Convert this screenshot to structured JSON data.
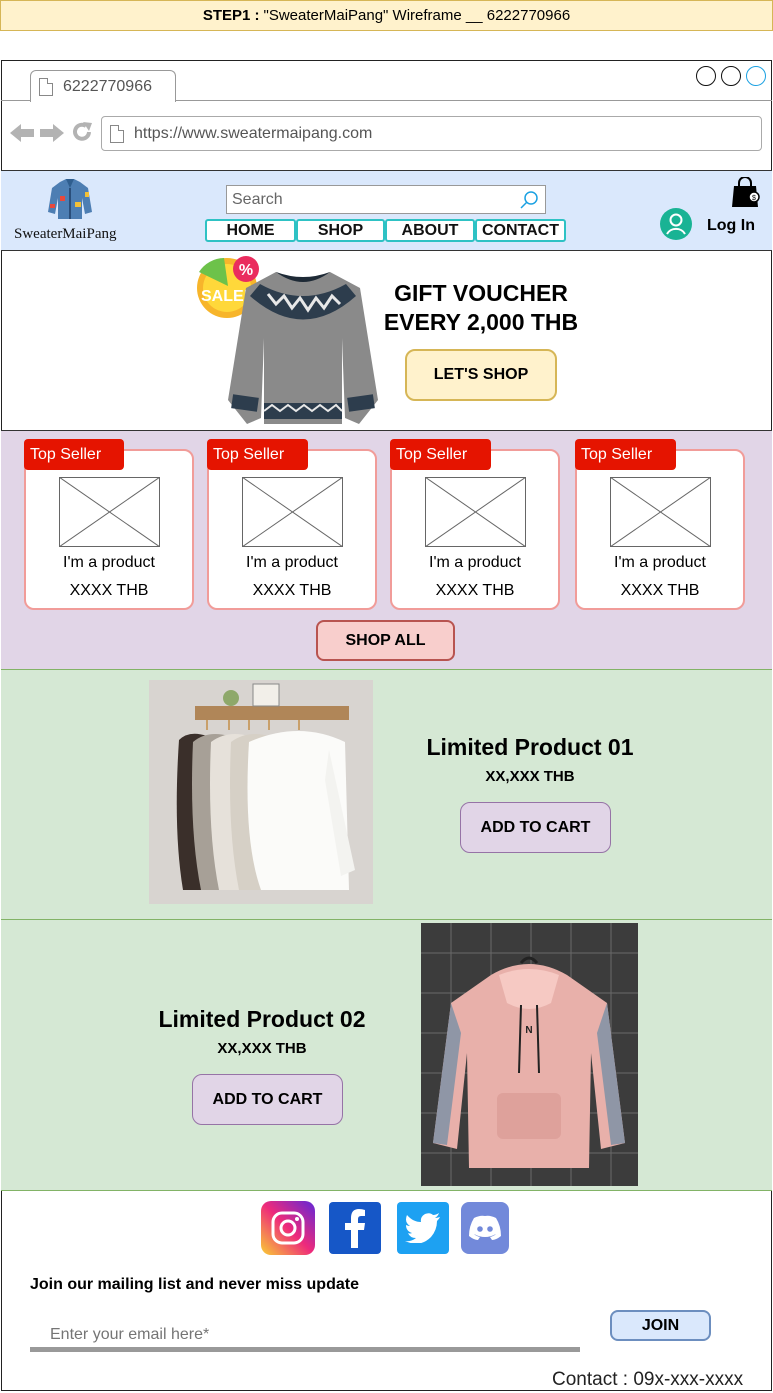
{
  "banner": {
    "prefix": "STEP1 :",
    "text": "\"SweaterMaiPang\" Wireframe __ 6222770966"
  },
  "browser": {
    "tab_title": "6222770966",
    "url": "https://www.sweatermaipang.com"
  },
  "header": {
    "brand": "SweaterMaiPang",
    "search_placeholder": "Search",
    "nav": [
      "HOME",
      "SHOP",
      "ABOUT",
      "CONTACT"
    ],
    "login": "Log In"
  },
  "hero": {
    "sale_badge": "SALE!",
    "sale_percent": "%",
    "title_line1": "GIFT VOUCHER",
    "title_line2": "EVERY 2,000 THB",
    "cta": "LET'S SHOP"
  },
  "top_sellers": {
    "items": [
      {
        "tag": "Top Seller",
        "name": "I'm a product",
        "price": "XXXX THB"
      },
      {
        "tag": "Top Seller",
        "name": "I'm a product",
        "price": "XXXX THB"
      },
      {
        "tag": "Top Seller",
        "name": "I'm a product",
        "price": "XXXX THB"
      },
      {
        "tag": "Top Seller",
        "name": "I'm a product",
        "price": "XXXX THB"
      }
    ],
    "shop_all": "SHOP ALL"
  },
  "limited": [
    {
      "title": "Limited Product 01",
      "price": "XX,XXX THB",
      "cta": "ADD TO CART"
    },
    {
      "title": "Limited Product 02",
      "price": "XX,XXX THB",
      "cta": "ADD TO CART"
    }
  ],
  "footer": {
    "social": [
      "instagram",
      "facebook",
      "twitter",
      "discord"
    ],
    "mailing_title": "Join our mailing list and never miss update",
    "email_placeholder": "Enter your email here*",
    "join": "JOIN",
    "contact": "Contact : 09x-xxx-xxxx"
  },
  "colors": {
    "header_bg": "#dae8fc",
    "sellers_bg": "#e1d5e7",
    "limited_bg": "#d5e8d4",
    "tag_red": "#e51400",
    "nav_border": "#2ec2c4"
  }
}
